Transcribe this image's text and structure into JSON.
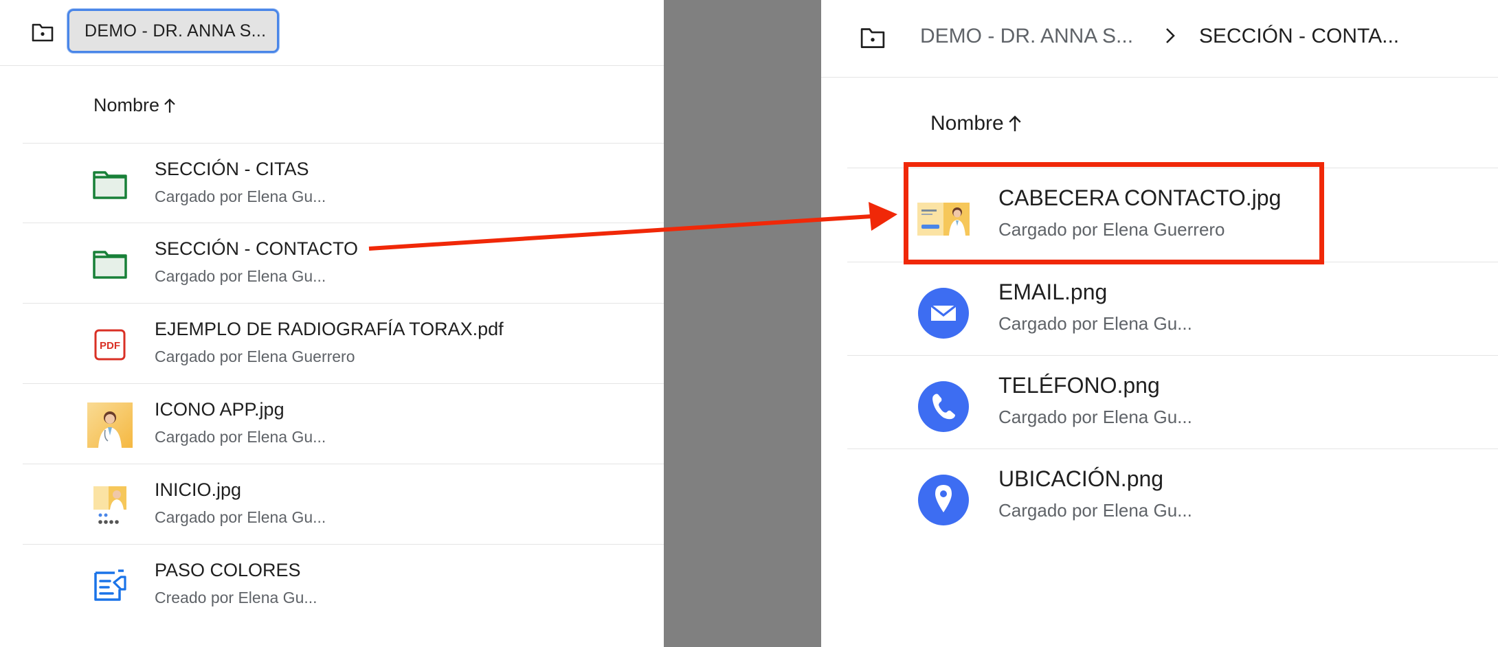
{
  "left_panel": {
    "breadcrumb": "DEMO - DR. ANNA S...",
    "column_header": "Nombre",
    "rows": [
      {
        "name": "SECCIÓN - CITAS",
        "subtitle": "Cargado por Elena Gu...",
        "icon": "folder-icon"
      },
      {
        "name": "SECCIÓN - CONTACTO",
        "subtitle": "Cargado por Elena Gu...",
        "icon": "folder-icon"
      },
      {
        "name": "EJEMPLO DE RADIOGRAFÍA TORAX.pdf",
        "subtitle": "Cargado por Elena Guerrero",
        "icon": "pdf-icon",
        "icon_label": "PDF"
      },
      {
        "name": "ICONO APP.jpg",
        "subtitle": "Cargado por Elena Gu...",
        "icon": "image-thumbnail"
      },
      {
        "name": "INICIO.jpg",
        "subtitle": "Cargado por Elena Gu...",
        "icon": "image-thumbnail"
      },
      {
        "name": "PASO COLORES",
        "subtitle": "Creado por Elena Gu...",
        "icon": "form-icon"
      }
    ]
  },
  "right_panel": {
    "breadcrumb": [
      "DEMO - DR. ANNA S...",
      "SECCIÓN - CONTA..."
    ],
    "column_header": "Nombre",
    "rows": [
      {
        "name": "CABECERA CONTACTO.jpg",
        "subtitle": "Cargado por Elena Guerrero",
        "icon": "image-thumbnail",
        "highlighted": true
      },
      {
        "name": "EMAIL.png",
        "subtitle": "Cargado por Elena Gu...",
        "icon": "email-icon"
      },
      {
        "name": "TELÉFONO.png",
        "subtitle": "Cargado por Elena Gu...",
        "icon": "phone-icon"
      },
      {
        "name": "UBICACIÓN.png",
        "subtitle": "Cargado por Elena Gu...",
        "icon": "location-icon"
      }
    ]
  },
  "colors": {
    "folder_green": "#188038",
    "folder_fill": "#e6f0e8",
    "pdf_red": "#d93025",
    "icon_blue": "#3d6df2",
    "form_blue": "#1a73e8",
    "annotation_red": "#f02808",
    "divider_gray": "#808080"
  }
}
